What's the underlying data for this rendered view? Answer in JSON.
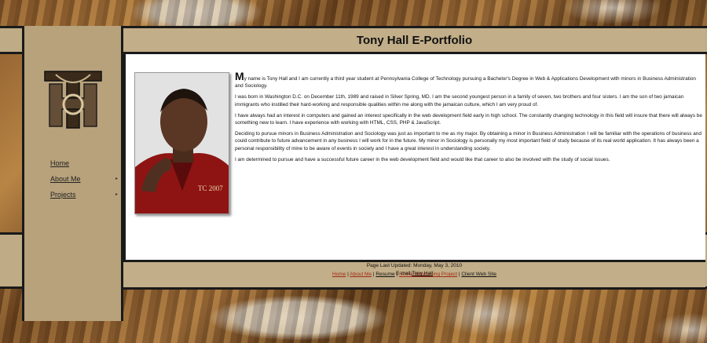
{
  "header": {
    "title": "Tony Hall E-Portfolio"
  },
  "sidebar": {
    "logo_alt": "TH",
    "nav": [
      {
        "label": "Home",
        "has_submenu": false
      },
      {
        "label": "About Me",
        "has_submenu": true
      },
      {
        "label": "Projects",
        "has_submenu": true
      }
    ],
    "submenu_arrow": "▸"
  },
  "content": {
    "photo_caption": "TC 2007",
    "dropcap": "M",
    "paragraphs": [
      "y name is Tony Hall and I am currently a third year student at Pennsylvania College of Technology pursuing a Bachelor's Degree in Web & Applications Development with minors in Business Administration and Sociology.",
      "I was born in Washington D.C. on December 11th, 1989 and raised in Silver Spring, MD. I am the second youngest person in a family of seven, two brothers and four sisters. I am the son of two jamaican immigrants who instilled their hard-working and responsible qualities within me along with the jamaican culture, which I am very proud of.",
      "I have always had an interest in computers and gained an interest specifically in the web development field early in high school. The constantly changing technology in this field will insure that there will always be something new to learn. I have experience with working with HTML, CSS, PHP & JavaScript.",
      "Deciding to pursue minors in Business Administration and Sociology was just as important to me as my major. By obtaining a minor in Business Administration I will be familiar with the operations of business and could contribute to future advancement in any business I will work for in the future. My minor in Sociology is personally my most important field of study because of its real world application. It has always been a personal responsibility of mine to be aware of events in society and I have a great interest in understanding society.",
      "I am determined to pursue and have a successful future career in the web development field and would like that career to also be involved with the study of social issues."
    ]
  },
  "footer": {
    "links": [
      {
        "label": "Home",
        "color": "#a02a14"
      },
      {
        "label": "About Me",
        "color": "#a02a14"
      },
      {
        "label": "Resume",
        "color": "#111111"
      },
      {
        "label": "Social Networking Project",
        "color": "#a02a14"
      },
      {
        "label": "Client Web Site",
        "color": "#111111"
      }
    ],
    "separator": "|",
    "last_updated": "Page Last Updated: Monday, May 3, 2010",
    "email_prefix": "E-mail:",
    "email_link": "Tony Hall"
  },
  "colors": {
    "accent_link": "#a02a14",
    "band": "#c2ae88",
    "sidebar": "#b8a27c"
  }
}
